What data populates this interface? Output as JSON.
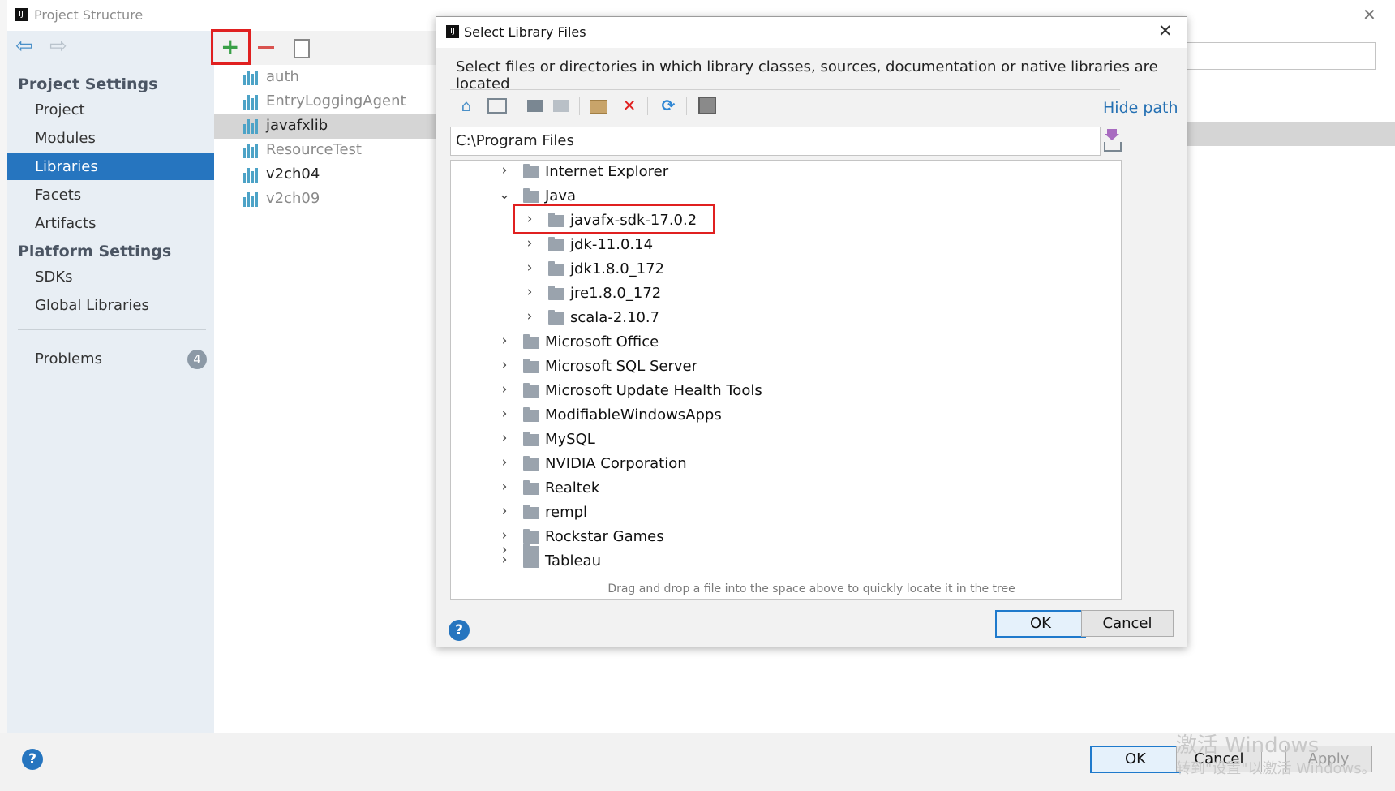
{
  "window": {
    "title": "Project Structure",
    "close_icon": "close-icon"
  },
  "sidebar": {
    "project_settings_header": "Project Settings",
    "project_items": [
      {
        "label": "Project"
      },
      {
        "label": "Modules"
      },
      {
        "label": "Libraries",
        "selected": true
      },
      {
        "label": "Facets"
      },
      {
        "label": "Artifacts"
      }
    ],
    "platform_settings_header": "Platform Settings",
    "platform_items": [
      {
        "label": "SDKs"
      },
      {
        "label": "Global Libraries"
      }
    ],
    "problems_label": "Problems",
    "problems_count": "4"
  },
  "libraries": {
    "items": [
      {
        "label": "auth",
        "dimmed": true
      },
      {
        "label": "EntryLoggingAgent",
        "dimmed": true
      },
      {
        "label": "javafxlib",
        "selected": true
      },
      {
        "label": "ResourceTest",
        "dimmed": true
      },
      {
        "label": "v2ch04"
      },
      {
        "label": "v2ch09",
        "dimmed": true
      }
    ]
  },
  "bottom": {
    "help": "?",
    "ok_label": "OK",
    "cancel_label": "Cancel",
    "apply_label": "Apply",
    "watermark_line1": "激活 Windows",
    "watermark_line2": "转到\"设置\"以激活 Windows。"
  },
  "dialog": {
    "title": "Select Library Files",
    "description": "Select files or directories in which library classes, sources, documentation or native libraries are located",
    "hide_path_label": "Hide path",
    "path_value": "C:\\Program Files",
    "tree": [
      {
        "label": "Internet Explorer",
        "depth": 0,
        "expanded": false
      },
      {
        "label": "Java",
        "depth": 0,
        "expanded": true
      },
      {
        "label": "javafx-sdk-17.0.2",
        "depth": 1,
        "expanded": false,
        "highlighted": true
      },
      {
        "label": "jdk-11.0.14",
        "depth": 1,
        "expanded": false
      },
      {
        "label": "jdk1.8.0_172",
        "depth": 1,
        "expanded": false
      },
      {
        "label": "jre1.8.0_172",
        "depth": 1,
        "expanded": false
      },
      {
        "label": "scala-2.10.7",
        "depth": 1,
        "expanded": false
      },
      {
        "label": "Microsoft Office",
        "depth": 0,
        "expanded": false
      },
      {
        "label": "Microsoft SQL Server",
        "depth": 0,
        "expanded": false
      },
      {
        "label": "Microsoft Update Health Tools",
        "depth": 0,
        "expanded": false
      },
      {
        "label": "ModifiableWindowsApps",
        "depth": 0,
        "expanded": false
      },
      {
        "label": "MySQL",
        "depth": 0,
        "expanded": false
      },
      {
        "label": "NVIDIA Corporation",
        "depth": 0,
        "expanded": false
      },
      {
        "label": "Realtek",
        "depth": 0,
        "expanded": false
      },
      {
        "label": "rempl",
        "depth": 0,
        "expanded": false
      },
      {
        "label": "Rockstar Games",
        "depth": 0,
        "expanded": false
      },
      {
        "label": "Tableau",
        "depth": 0,
        "expanded": false
      }
    ],
    "dnd_hint": "Drag and drop a file into the space above to quickly locate it in the tree",
    "help": "?",
    "ok_label": "OK",
    "cancel_label": "Cancel"
  },
  "colors": {
    "selection": "#2675bf",
    "accent": "#1f7acc",
    "highlight_box": "#e02020"
  }
}
